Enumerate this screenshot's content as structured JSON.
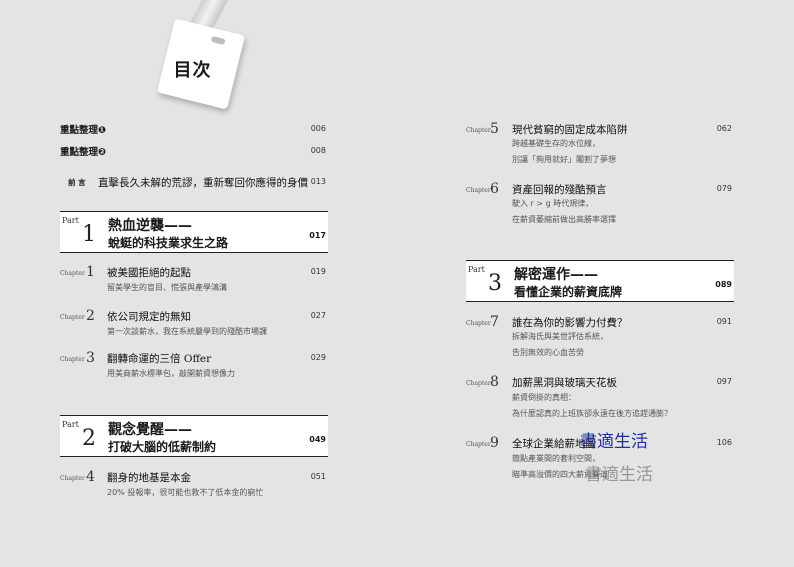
{
  "tag": {
    "title": "目次"
  },
  "left": {
    "highlights": [
      {
        "title": "重點整理❶",
        "page": "006"
      },
      {
        "title": "重點整理❷",
        "page": "008"
      }
    ],
    "preface": {
      "label": "前 言",
      "title": "直擊長久未解的荒謬，重新奪回你應得的身價",
      "page": "013"
    },
    "parts": [
      {
        "label": "Part",
        "num": "1",
        "title1": "熱血逆襲——",
        "title2": "蛻蜓的科技業求生之路",
        "page": "017",
        "chapters": [
          {
            "label": "Chapter",
            "num": "1",
            "title": "被美國拒絕的起點",
            "subs": [
              "留美學生的盲目、慌張與產學鴻溝"
            ],
            "page": "019"
          },
          {
            "label": "Chapter",
            "num": "2",
            "title": "依公司規定的無知",
            "subs": [
              "第一次談薪水，我在系統嚴學到的殘酷市場課"
            ],
            "page": "027"
          },
          {
            "label": "Chapter",
            "num": "3",
            "title": "翻轉命運的三倍 Offer",
            "subs": [
              "用美商薪水標準包，敲開薪資想像力"
            ],
            "page": "029"
          }
        ]
      },
      {
        "label": "Part",
        "num": "2",
        "title1": "觀念覺醒——",
        "title2": "打破大腦的低薪制約",
        "page": "049",
        "chapters": [
          {
            "label": "Chapter",
            "num": "4",
            "title": "翻身的地基是本金",
            "subs": [
              "20% 投報率，很可能也救不了低本金的窮忙"
            ],
            "page": "051"
          }
        ]
      }
    ]
  },
  "right": {
    "chapters_top": [
      {
        "label": "Chapter",
        "num": "5",
        "title": "現代貧窮的固定成本陷阱",
        "subs": [
          "跨越基礎生存的水位線，",
          "別讓「夠用就好」閹割了夢想"
        ],
        "page": "062"
      },
      {
        "label": "Chapter",
        "num": "6",
        "title": "資產回報的殘酷預言",
        "subs": [
          "駛入 r > g 時代規律，",
          "在薪資萎縮前做出高勝率選擇"
        ],
        "page": "079"
      }
    ],
    "part": {
      "label": "Part",
      "num": "3",
      "title1": "解密運作——",
      "title2": "看懂企業的薪資底牌",
      "page": "089",
      "chapters": [
        {
          "label": "Chapter",
          "num": "7",
          "title": "誰在為你的影響力付費？",
          "subs": [
            "拆解海氏與美世評估系統，",
            "告別無效的心血苦勞"
          ],
          "page": "091"
        },
        {
          "label": "Chapter",
          "num": "8",
          "title": "加薪黑洞與玻璃天花板",
          "subs": [
            "薪資倒掛的真相：",
            "為什麼認真的上班族卻永遠在後方追趕通膨？"
          ],
          "page": "097"
        },
        {
          "label": "Chapter",
          "num": "9",
          "title": "全球企業給薪地圖",
          "subs": [
            "簡點產業間的套利空間，",
            "瞄準高溢價的四大薪資賽道"
          ],
          "page": "106"
        }
      ]
    }
  },
  "watermark": {
    "text1": "書適生活",
    "text2": "書適生活"
  }
}
